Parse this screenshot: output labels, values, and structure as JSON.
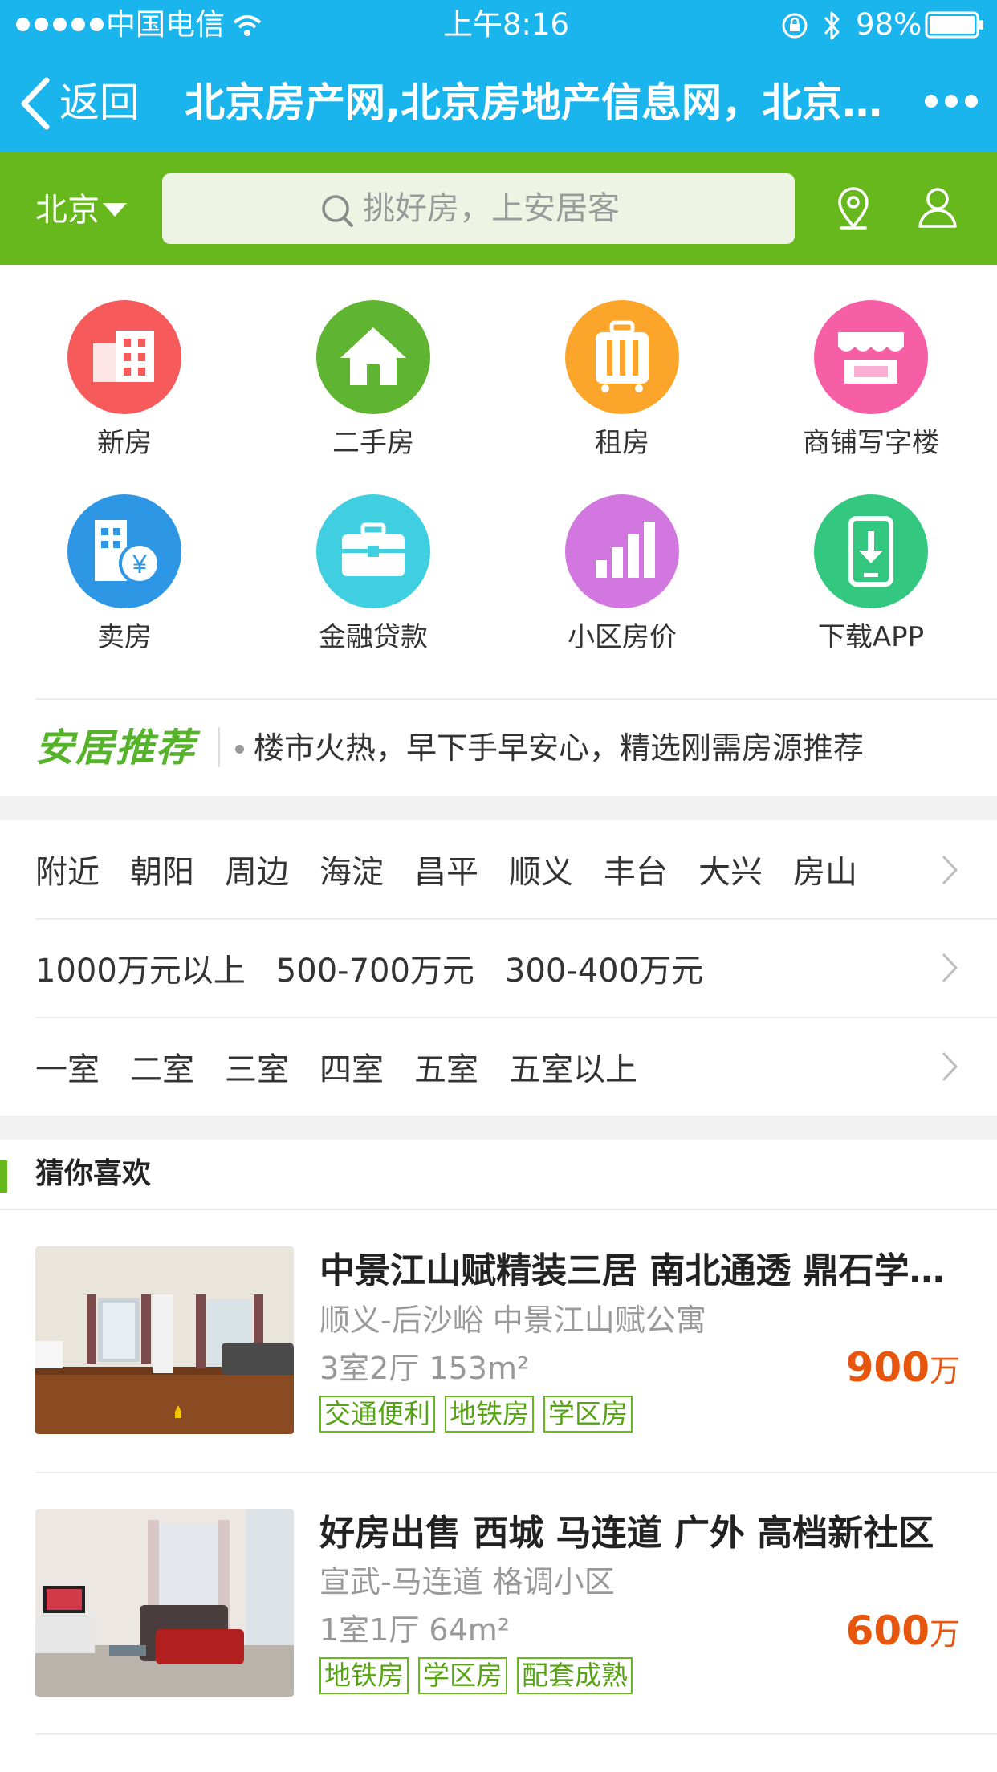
{
  "status_bar": {
    "carrier": "中国电信",
    "time": "上午8:16",
    "battery": "98%"
  },
  "nav": {
    "back_label": "返回",
    "title": "北京房产网,北京房地产信息网，北京房产信息网"
  },
  "search": {
    "city": "北京",
    "placeholder": "挑好房，上安居客"
  },
  "categories": [
    {
      "label": "新房",
      "color": "#f65a5a",
      "icon": "building-icon"
    },
    {
      "label": "二手房",
      "color": "#5fb531",
      "icon": "house-icon"
    },
    {
      "label": "租房",
      "color": "#fba62a",
      "icon": "luggage-icon"
    },
    {
      "label": "商铺写字楼",
      "color": "#f65fa5",
      "icon": "shop-awning-icon"
    },
    {
      "label": "卖房",
      "color": "#2d97e6",
      "icon": "building-money-icon"
    },
    {
      "label": "金融贷款",
      "color": "#3fcfe0",
      "icon": "briefcase-icon"
    },
    {
      "label": "小区房价",
      "color": "#d377e0",
      "icon": "bar-chart-icon"
    },
    {
      "label": "下载APP",
      "color": "#33c77f",
      "icon": "phone-download-icon"
    }
  ],
  "recommend": {
    "logo": "安居推荐",
    "text": "楼市火热，早下手早安心，精选刚需房源推荐"
  },
  "filters": {
    "areas": [
      "附近",
      "朝阳",
      "周边",
      "海淀",
      "昌平",
      "顺义",
      "丰台",
      "大兴",
      "房山"
    ],
    "prices": [
      "1000万元以上",
      "500-700万元",
      "300-400万元"
    ],
    "rooms": [
      "一室",
      "二室",
      "三室",
      "四室",
      "五室",
      "五室以上"
    ]
  },
  "guess": {
    "title": "猜你喜欢"
  },
  "listings": [
    {
      "title": "中景江山赋精装三居 南北通透 鼎石学校旁",
      "location": "顺义-后沙峪 中景江山赋公寓",
      "layout": "3室2厅 153m²",
      "price": "900",
      "unit": "万",
      "tags": [
        "交通便利",
        "地铁房",
        "学区房"
      ]
    },
    {
      "title": "好房出售 西城 马连道 广外 高档新社区",
      "location": "宣武-马连道 格调小区",
      "layout": "1室1厅 64m²",
      "price": "600",
      "unit": "万",
      "tags": [
        "地铁房",
        "学区房",
        "配套成熟"
      ]
    }
  ]
}
